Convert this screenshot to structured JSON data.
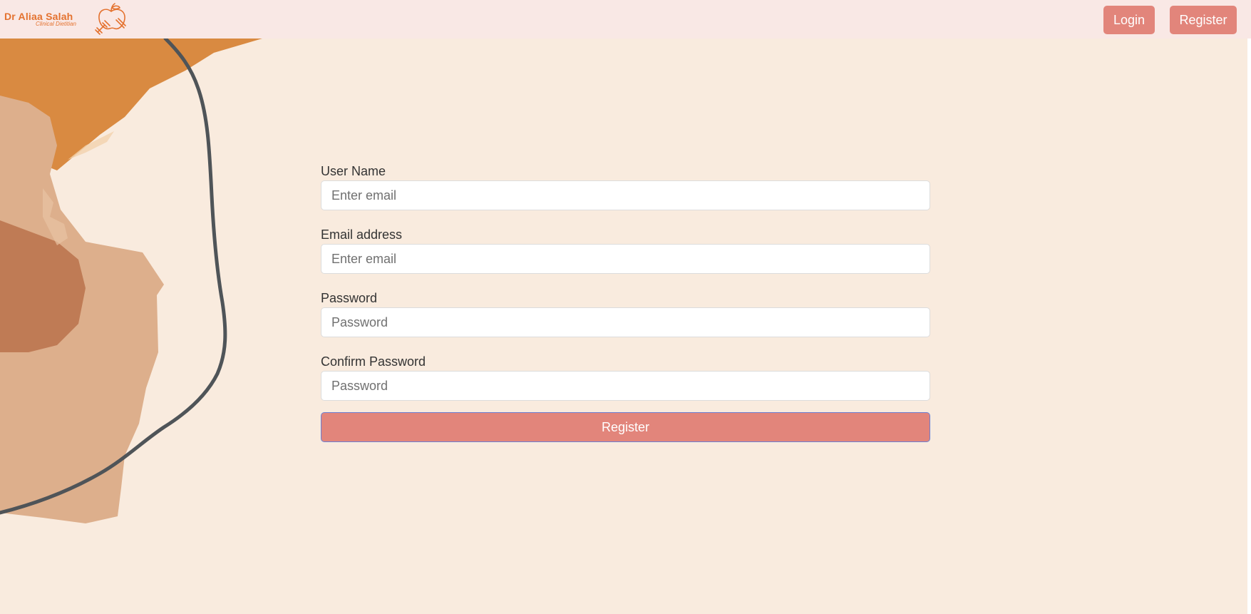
{
  "brand": {
    "name": "Dr Aliaa Salah",
    "subtitle": "Clinical Dietitian",
    "logo_icon": "apple-dumbbell-icon",
    "color": "#e4722f"
  },
  "nav": {
    "login_label": "Login",
    "register_label": "Register"
  },
  "form": {
    "fields": [
      {
        "label": "User Name",
        "placeholder": "Enter email",
        "type": "text"
      },
      {
        "label": "Email address",
        "placeholder": "Enter email",
        "type": "email"
      },
      {
        "label": "Password",
        "placeholder": "Password",
        "type": "password"
      },
      {
        "label": "Confirm Password",
        "placeholder": "Password",
        "type": "password"
      }
    ],
    "submit_label": "Register"
  },
  "colors": {
    "page_background": "#f9ebde",
    "navbar_background": "#f9e8e5",
    "accent_button": "#e2857b",
    "art_orange": "#d98a41",
    "art_tan": "#ddaf8c",
    "art_brown": "#bf7b55",
    "art_line": "#4f5458"
  }
}
